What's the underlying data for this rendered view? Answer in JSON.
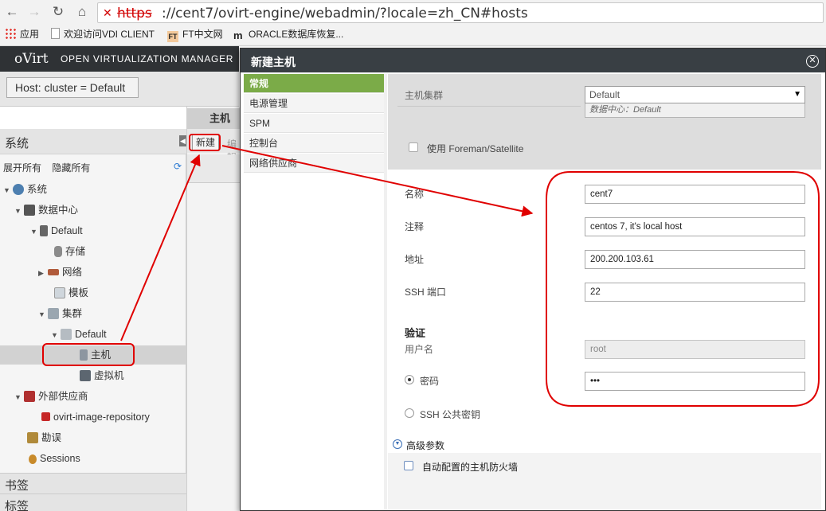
{
  "browser": {
    "url_scheme": "https",
    "url_rest": "://cent7/ovirt-engine/webadmin/?locale=zh_CN#hosts",
    "bookmarks": [
      "应用",
      "欢迎访问VDI CLIENT",
      "FT中文网",
      "ORACLE数据库恢复..."
    ],
    "ft_badge": "FT",
    "oracle_badge": "m"
  },
  "app": {
    "logo": "oVirt",
    "title": "OPEN VIRTUALIZATION MANAGER",
    "search_query": "Host: cluster = Default"
  },
  "tree": {
    "heading": "系统",
    "expand_all": "展开所有",
    "collapse_all": "隐藏所有",
    "nodes": [
      "系统",
      "数据中心",
      "Default",
      "存储",
      "网络",
      "模板",
      "集群",
      "Default",
      "主机",
      "虚拟机",
      "外部供应商",
      "ovirt-image-repository",
      "勘误",
      "Sessions"
    ],
    "bookmarks_heading": "书签",
    "tags_heading": "标签"
  },
  "main": {
    "tab": "主机",
    "new_button": "新建",
    "edit_button": "编辑"
  },
  "dialog": {
    "title": "新建主机",
    "nav": [
      "常规",
      "电源管理",
      "SPM",
      "控制台",
      "网络供应商"
    ],
    "cluster_label": "主机集群",
    "cluster_value": "Default",
    "cluster_sub": "数据中心：Default",
    "foreman_label": "使用 Foreman/Satellite",
    "name_label": "名称",
    "name_value": "cent7",
    "comment_label": "注释",
    "comment_value": "centos 7, it's local host",
    "address_label": "地址",
    "address_value": "200.200.103.61",
    "ssh_port_label": "SSH 端口",
    "ssh_port_value": "22",
    "auth_heading": "验证",
    "username_label": "用户名",
    "username_value": "root",
    "password_label": "密码",
    "password_value": "•••",
    "ssh_key_label": "SSH 公共密钥",
    "advanced_label": "高级参数",
    "firewall_label": "自动配置的主机防火墙"
  },
  "colors": {
    "nav_active": "#7bab48",
    "header_dark": "#393f44",
    "annotation_red": "#e00000"
  }
}
